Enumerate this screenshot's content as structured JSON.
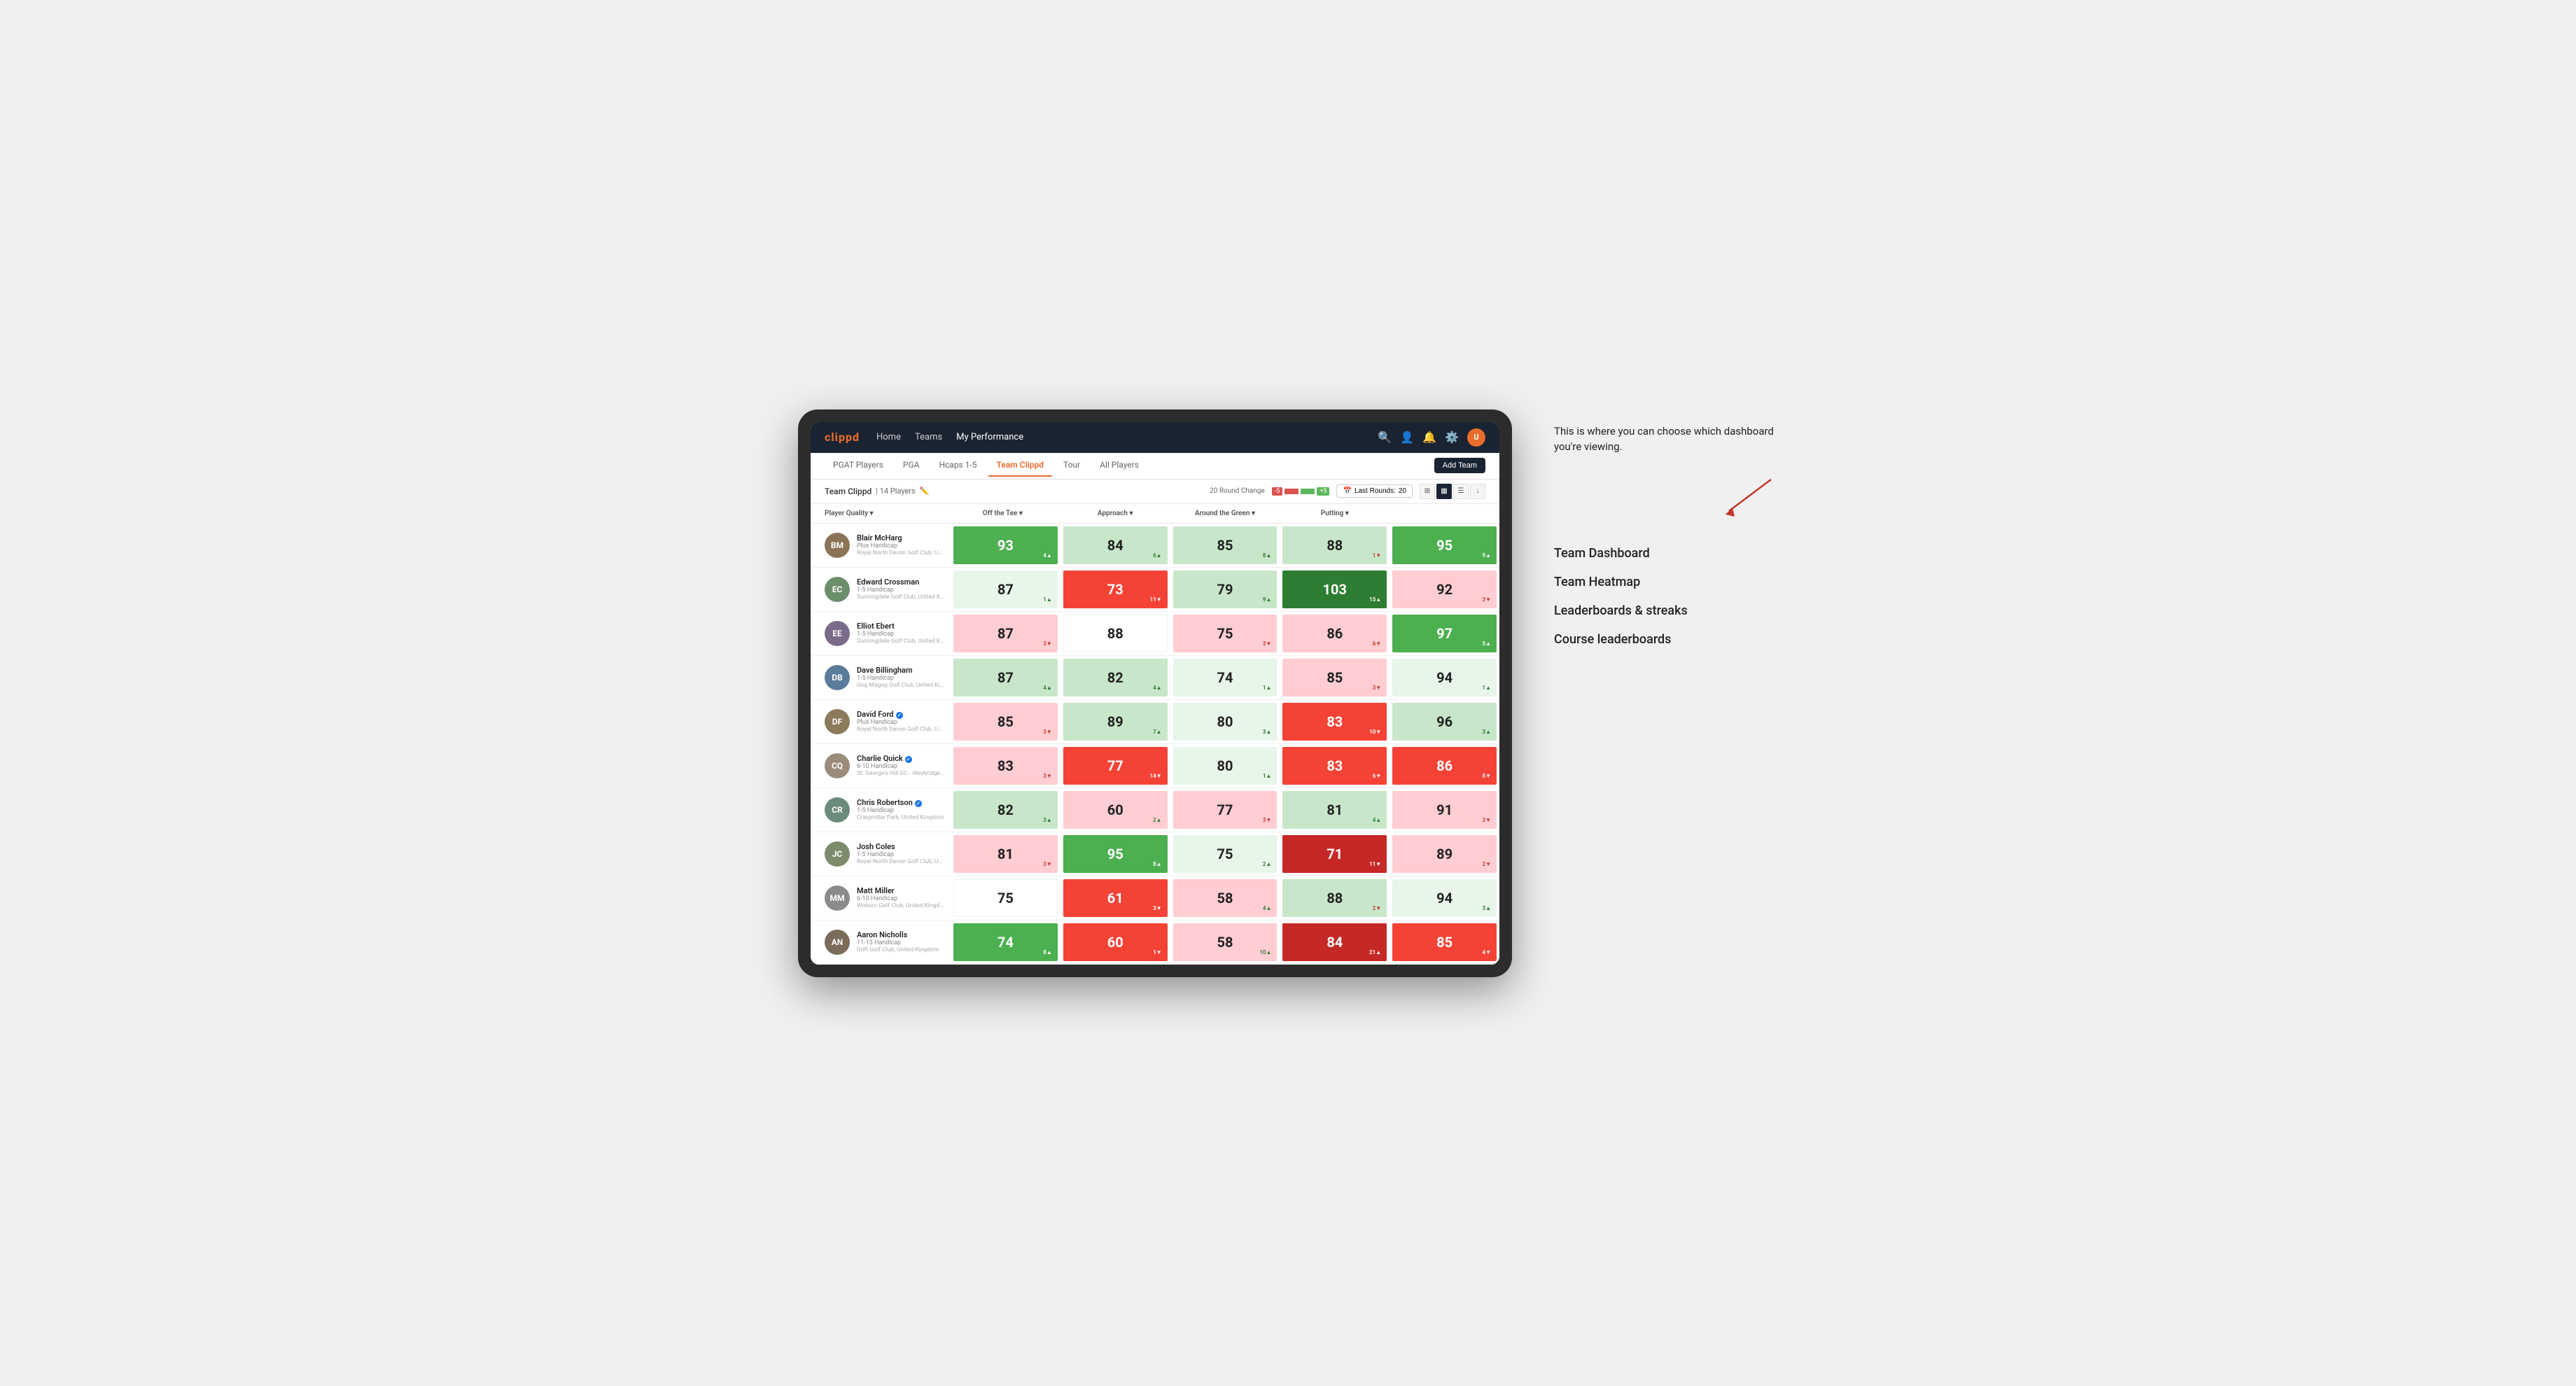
{
  "annotation": {
    "intro_text": "This is where you can choose which dashboard you're viewing.",
    "items": [
      {
        "label": "Team Dashboard"
      },
      {
        "label": "Team Heatmap"
      },
      {
        "label": "Leaderboards & streaks"
      },
      {
        "label": "Course leaderboards"
      }
    ]
  },
  "navbar": {
    "logo": "clippd",
    "links": [
      {
        "label": "Home",
        "active": false
      },
      {
        "label": "Teams",
        "active": false
      },
      {
        "label": "My Performance",
        "active": true
      }
    ]
  },
  "tabs": [
    {
      "label": "PGAT Players",
      "active": false
    },
    {
      "label": "PGA",
      "active": false
    },
    {
      "label": "Hcaps 1-5",
      "active": false
    },
    {
      "label": "Team Clippd",
      "active": true
    },
    {
      "label": "Tour",
      "active": false
    },
    {
      "label": "All Players",
      "active": false
    }
  ],
  "add_team_label": "Add Team",
  "toolbar": {
    "team_name": "Team Clippd",
    "player_count": "14 Players",
    "round_change_label": "20 Round Change",
    "round_neg": "-5",
    "round_pos": "+5",
    "last_rounds_label": "Last Rounds:",
    "last_rounds_value": "20"
  },
  "columns": [
    {
      "label": "Player Quality ▾"
    },
    {
      "label": "Off the Tee ▾"
    },
    {
      "label": "Approach ▾"
    },
    {
      "label": "Around the Green ▾"
    },
    {
      "label": "Putting ▾"
    }
  ],
  "players": [
    {
      "name": "Blair McHarg",
      "handicap": "Plus Handicap",
      "club": "Royal North Devon Golf Club, United Kingdom",
      "avatar_color": "#8B7355",
      "initials": "BM",
      "scores": [
        {
          "value": "93",
          "delta": "4▲",
          "bg": "bg-green",
          "white": true,
          "delta_class": "delta-up-white"
        },
        {
          "value": "84",
          "delta": "6▲",
          "bg": "bg-light-green",
          "white": false,
          "delta_class": "delta-up"
        },
        {
          "value": "85",
          "delta": "8▲",
          "bg": "bg-light-green",
          "white": false,
          "delta_class": "delta-up"
        },
        {
          "value": "88",
          "delta": "1▼",
          "bg": "bg-light-green",
          "white": false,
          "delta_class": "delta-down"
        },
        {
          "value": "95",
          "delta": "9▲",
          "bg": "bg-green",
          "white": true,
          "delta_class": "delta-up-white"
        }
      ]
    },
    {
      "name": "Edward Crossman",
      "handicap": "1-5 Handicap",
      "club": "Sunningdale Golf Club, United Kingdom",
      "avatar_color": "#6B8E6B",
      "initials": "EC",
      "scores": [
        {
          "value": "87",
          "delta": "1▲",
          "bg": "bg-very-light-green",
          "white": false,
          "delta_class": "delta-up"
        },
        {
          "value": "73",
          "delta": "11▼",
          "bg": "bg-red",
          "white": true,
          "delta_class": "delta-down-white"
        },
        {
          "value": "79",
          "delta": "9▲",
          "bg": "bg-light-green",
          "white": false,
          "delta_class": "delta-up"
        },
        {
          "value": "103",
          "delta": "15▲",
          "bg": "bg-dark-green",
          "white": true,
          "delta_class": "delta-up-white"
        },
        {
          "value": "92",
          "delta": "3▼",
          "bg": "bg-light-red",
          "white": false,
          "delta_class": "delta-down"
        }
      ]
    },
    {
      "name": "Elliot Ebert",
      "handicap": "1-5 Handicap",
      "club": "Sunningdale Golf Club, United Kingdom",
      "avatar_color": "#7B6B8B",
      "initials": "EE",
      "scores": [
        {
          "value": "87",
          "delta": "3▼",
          "bg": "bg-light-red",
          "white": false,
          "delta_class": "delta-down"
        },
        {
          "value": "88",
          "delta": "",
          "bg": "bg-white",
          "white": false,
          "delta_class": ""
        },
        {
          "value": "75",
          "delta": "3▼",
          "bg": "bg-light-red",
          "white": false,
          "delta_class": "delta-down"
        },
        {
          "value": "86",
          "delta": "6▼",
          "bg": "bg-light-red",
          "white": false,
          "delta_class": "delta-down"
        },
        {
          "value": "97",
          "delta": "5▲",
          "bg": "bg-green",
          "white": true,
          "delta_class": "delta-up-white"
        }
      ]
    },
    {
      "name": "Dave Billingham",
      "handicap": "1-5 Handicap",
      "club": "Gog Magog Golf Club, United Kingdom",
      "avatar_color": "#5B7B9B",
      "initials": "DB",
      "scores": [
        {
          "value": "87",
          "delta": "4▲",
          "bg": "bg-light-green",
          "white": false,
          "delta_class": "delta-up"
        },
        {
          "value": "82",
          "delta": "4▲",
          "bg": "bg-light-green",
          "white": false,
          "delta_class": "delta-up"
        },
        {
          "value": "74",
          "delta": "1▲",
          "bg": "bg-very-light-green",
          "white": false,
          "delta_class": "delta-up"
        },
        {
          "value": "85",
          "delta": "3▼",
          "bg": "bg-light-red",
          "white": false,
          "delta_class": "delta-down"
        },
        {
          "value": "94",
          "delta": "1▲",
          "bg": "bg-very-light-green",
          "white": false,
          "delta_class": "delta-up"
        }
      ]
    },
    {
      "name": "David Ford",
      "handicap": "Plus Handicap",
      "club": "Royal North Devon Golf Club, United Kingdom",
      "avatar_color": "#8B7B5B",
      "initials": "DF",
      "verified": true,
      "scores": [
        {
          "value": "85",
          "delta": "3▼",
          "bg": "bg-light-red",
          "white": false,
          "delta_class": "delta-down"
        },
        {
          "value": "89",
          "delta": "7▲",
          "bg": "bg-light-green",
          "white": false,
          "delta_class": "delta-up"
        },
        {
          "value": "80",
          "delta": "3▲",
          "bg": "bg-very-light-green",
          "white": false,
          "delta_class": "delta-up"
        },
        {
          "value": "83",
          "delta": "10▼",
          "bg": "bg-red",
          "white": true,
          "delta_class": "delta-down-white"
        },
        {
          "value": "96",
          "delta": "3▲",
          "bg": "bg-light-green",
          "white": false,
          "delta_class": "delta-up"
        }
      ]
    },
    {
      "name": "Charlie Quick",
      "handicap": "6-10 Handicap",
      "club": "St. George's Hill GC - Weybridge - Surrey, Uni...",
      "avatar_color": "#9B8B7B",
      "initials": "CQ",
      "verified": true,
      "scores": [
        {
          "value": "83",
          "delta": "3▼",
          "bg": "bg-light-red",
          "white": false,
          "delta_class": "delta-down"
        },
        {
          "value": "77",
          "delta": "14▼",
          "bg": "bg-red",
          "white": true,
          "delta_class": "delta-down-white"
        },
        {
          "value": "80",
          "delta": "1▲",
          "bg": "bg-very-light-green",
          "white": false,
          "delta_class": "delta-up"
        },
        {
          "value": "83",
          "delta": "6▼",
          "bg": "bg-red",
          "white": true,
          "delta_class": "delta-down-white"
        },
        {
          "value": "86",
          "delta": "8▼",
          "bg": "bg-red",
          "white": true,
          "delta_class": "delta-down-white"
        }
      ]
    },
    {
      "name": "Chris Robertson",
      "handicap": "1-5 Handicap",
      "club": "Craigmillar Park, United Kingdom",
      "avatar_color": "#6B8B7B",
      "initials": "CR",
      "verified": true,
      "scores": [
        {
          "value": "82",
          "delta": "3▲",
          "bg": "bg-light-green",
          "white": false,
          "delta_class": "delta-up"
        },
        {
          "value": "60",
          "delta": "2▲",
          "bg": "bg-light-red",
          "white": false,
          "delta_class": "delta-up"
        },
        {
          "value": "77",
          "delta": "3▼",
          "bg": "bg-light-red",
          "white": false,
          "delta_class": "delta-down"
        },
        {
          "value": "81",
          "delta": "4▲",
          "bg": "bg-light-green",
          "white": false,
          "delta_class": "delta-up"
        },
        {
          "value": "91",
          "delta": "3▼",
          "bg": "bg-light-red",
          "white": false,
          "delta_class": "delta-down"
        }
      ]
    },
    {
      "name": "Josh Coles",
      "handicap": "1-5 Handicap",
      "club": "Royal North Devon Golf Club, United Kingdom",
      "avatar_color": "#7B8B6B",
      "initials": "JC",
      "scores": [
        {
          "value": "81",
          "delta": "3▼",
          "bg": "bg-light-red",
          "white": false,
          "delta_class": "delta-down"
        },
        {
          "value": "95",
          "delta": "8▲",
          "bg": "bg-green",
          "white": true,
          "delta_class": "delta-up-white"
        },
        {
          "value": "75",
          "delta": "2▲",
          "bg": "bg-very-light-green",
          "white": false,
          "delta_class": "delta-up"
        },
        {
          "value": "71",
          "delta": "11▼",
          "bg": "bg-dark-red",
          "white": true,
          "delta_class": "delta-down-white"
        },
        {
          "value": "89",
          "delta": "2▼",
          "bg": "bg-light-red",
          "white": false,
          "delta_class": "delta-down"
        }
      ]
    },
    {
      "name": "Matt Miller",
      "handicap": "6-10 Handicap",
      "club": "Woburn Golf Club, United Kingdom",
      "avatar_color": "#8B8B8B",
      "initials": "MM",
      "scores": [
        {
          "value": "75",
          "delta": "",
          "bg": "bg-white",
          "white": false,
          "delta_class": ""
        },
        {
          "value": "61",
          "delta": "3▼",
          "bg": "bg-red",
          "white": true,
          "delta_class": "delta-down-white"
        },
        {
          "value": "58",
          "delta": "4▲",
          "bg": "bg-light-red",
          "white": false,
          "delta_class": "delta-up"
        },
        {
          "value": "88",
          "delta": "2▼",
          "bg": "bg-light-green",
          "white": false,
          "delta_class": "delta-down"
        },
        {
          "value": "94",
          "delta": "3▲",
          "bg": "bg-very-light-green",
          "white": false,
          "delta_class": "delta-up"
        }
      ]
    },
    {
      "name": "Aaron Nicholls",
      "handicap": "11-15 Handicap",
      "club": "Drift Golf Club, United Kingdom",
      "avatar_color": "#7B6B5B",
      "initials": "AN",
      "scores": [
        {
          "value": "74",
          "delta": "8▲",
          "bg": "bg-green",
          "white": true,
          "delta_class": "delta-up-white"
        },
        {
          "value": "60",
          "delta": "1▼",
          "bg": "bg-red",
          "white": true,
          "delta_class": "delta-down-white"
        },
        {
          "value": "58",
          "delta": "10▲",
          "bg": "bg-light-red",
          "white": false,
          "delta_class": "delta-up"
        },
        {
          "value": "84",
          "delta": "21▲",
          "bg": "bg-dark-red",
          "white": true,
          "delta_class": "delta-up-white"
        },
        {
          "value": "85",
          "delta": "4▼",
          "bg": "bg-red",
          "white": true,
          "delta_class": "delta-down-white"
        }
      ]
    }
  ]
}
